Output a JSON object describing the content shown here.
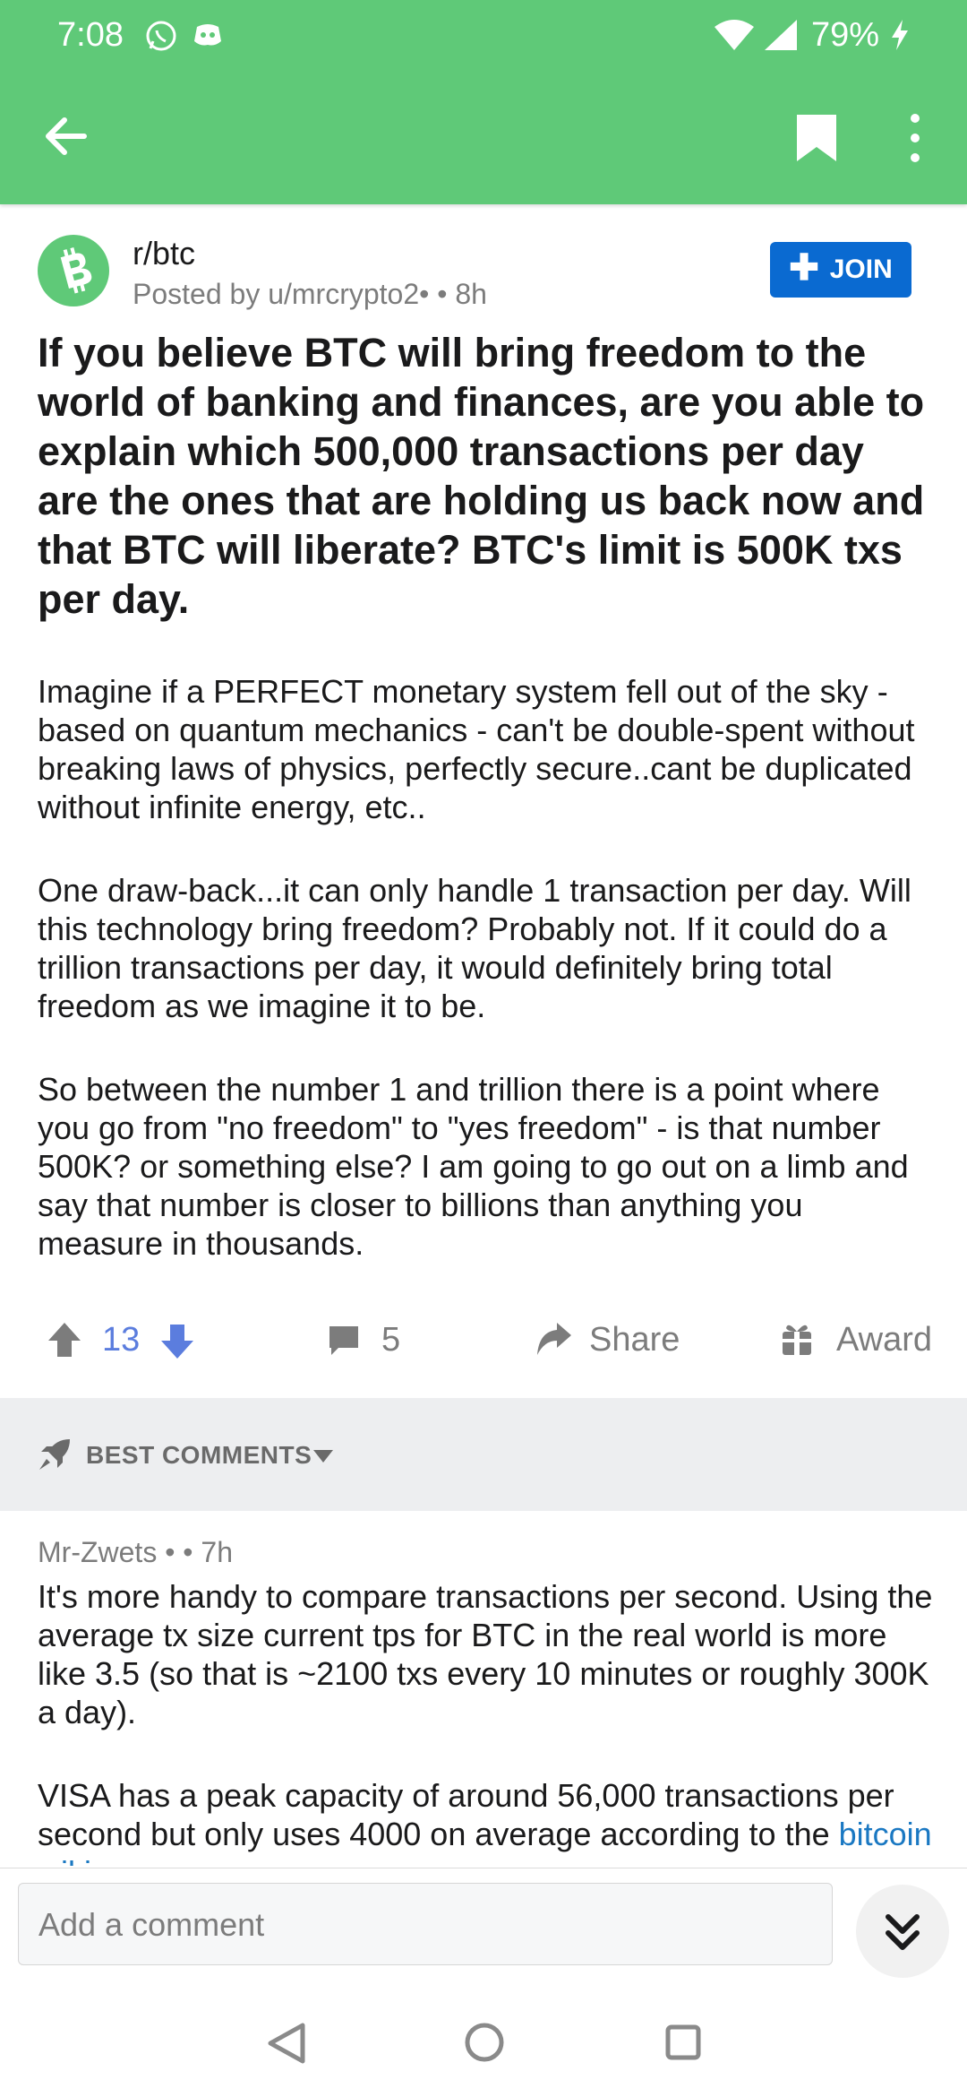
{
  "status_bar": {
    "time": "7:08",
    "battery": "79%"
  },
  "post": {
    "subreddit": "r/btc",
    "meta": "Posted by u/mrcrypto2•  • 8h",
    "join_label": "JOIN",
    "title": "If you believe BTC will bring freedom to the world of banking and finances, are you able to explain which 500,000 transactions per day are the ones that are holding us back now and that BTC will liberate? BTC's limit is 500K txs per day.",
    "paragraphs": [
      "Imagine if a PERFECT monetary system fell out of the sky - based on quantum mechanics - can't be double-spent without breaking laws of physics, perfectly secure..cant be duplicated without infinite energy, etc..",
      "One draw-back...it can only handle 1 transaction per day. Will this technology bring freedom? Probably not.  If it could do a trillion transactions per day, it would definitely bring total freedom as we imagine it to be.",
      "So between the number 1 and trillion there is a point where you go from \"no freedom\" to \"yes freedom\" - is that number 500K? or something else?  I am going to go out on a limb and say that number is closer to billions than anything you measure in thousands."
    ],
    "score": "13",
    "comment_count": "5",
    "share_label": "Share",
    "award_label": "Award"
  },
  "sort": {
    "label": "BEST COMMENTS"
  },
  "comment": {
    "meta": "Mr-Zwets •  • 7h",
    "paragraph1": "It's more handy to compare transactions per second. Using the average tx size current tps for BTC in the real world is more like 3.5 (so that is ~2100 txs every 10 minutes or roughly 300K a day).",
    "paragraph2": "VISA has a peak capacity of around 56,000 transactions per second but only uses 4000 on average according to the",
    "link_text": "bitcoin wiki"
  },
  "composer": {
    "placeholder": "Add a comment"
  },
  "colors": {
    "appbar": "#5fc978",
    "join": "#0a6ad1",
    "score": "#5b7dde"
  }
}
